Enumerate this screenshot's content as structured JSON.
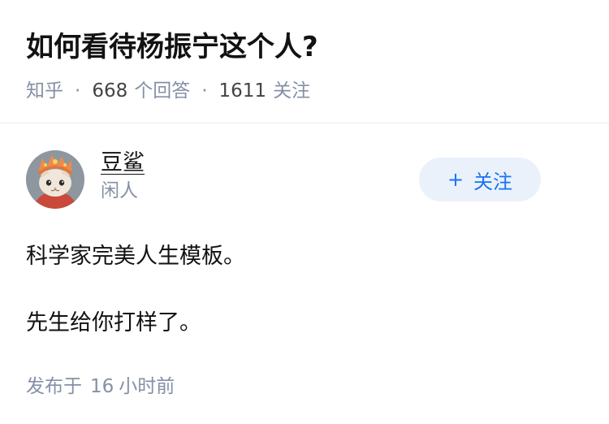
{
  "question": {
    "title": "如何看待杨振宁这个人?",
    "source": "知乎",
    "answer_count": "668",
    "answer_label": "个回答",
    "follow_count": "1611",
    "follow_label": "关注",
    "separator": "·"
  },
  "answer": {
    "author": {
      "name": "豆鲨",
      "bio": "闲人",
      "avatar_icon": "cat-avatar-icon"
    },
    "follow_button": {
      "plus": "+",
      "label": "关注"
    },
    "paragraphs": [
      "科学家完美人生模板。",
      "先生给你打样了。"
    ],
    "footer": {
      "prefix": "发布于",
      "num": "16",
      "unit": "小时前"
    }
  },
  "colors": {
    "accent": "#1772f6",
    "follow_bg": "#ebf1fa",
    "meta": "#8590a6",
    "text": "#121212"
  }
}
